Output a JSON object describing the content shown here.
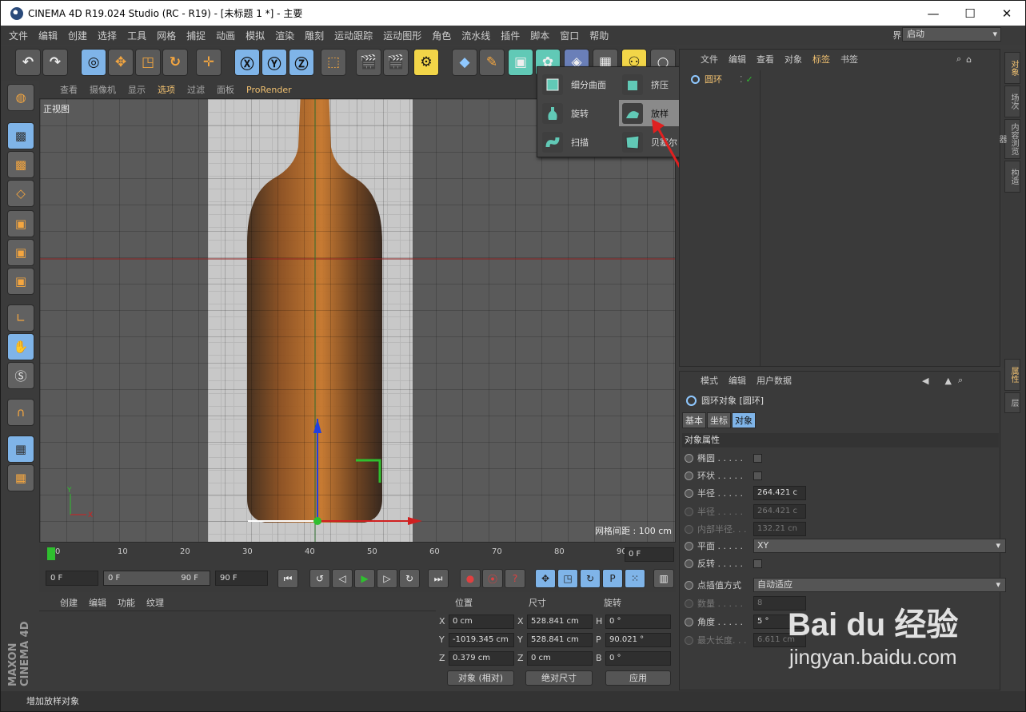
{
  "window": {
    "title": "CINEMA 4D R19.024 Studio (RC - R19) - [未标题 1 *] - 主要"
  },
  "menu": [
    "文件",
    "编辑",
    "创建",
    "选择",
    "工具",
    "网格",
    "捕捉",
    "动画",
    "模拟",
    "渲染",
    "雕刻",
    "运动跟踪",
    "运动图形",
    "角色",
    "流水线",
    "插件",
    "脚本",
    "窗口",
    "帮助"
  ],
  "layout": {
    "label": "界面:",
    "value": "启动"
  },
  "viewport_menu": [
    "查看",
    "摄像机",
    "显示",
    "选项",
    "过滤",
    "面板",
    "ProRender"
  ],
  "viewport": {
    "name": "正视图",
    "grid_info": "网格间距 : 100 cm"
  },
  "popup": {
    "items": [
      {
        "label": "细分曲面",
        "icon": "subdivision-surface-icon"
      },
      {
        "label": "挤压",
        "icon": "extrude-icon"
      },
      {
        "label": "旋转",
        "icon": "lathe-icon"
      },
      {
        "label": "放样",
        "icon": "loft-icon"
      },
      {
        "label": "扫描",
        "icon": "sweep-icon"
      },
      {
        "label": "贝塞尔",
        "icon": "bezier-icon"
      }
    ],
    "highlighted": "放样"
  },
  "timeline": {
    "ticks": [
      "0",
      "10",
      "20",
      "30",
      "40",
      "50",
      "60",
      "70",
      "80",
      "90"
    ],
    "current_frame": "0 F"
  },
  "transport": {
    "start": "0 F",
    "range_start": "0 F",
    "range_end": "90 F",
    "end": "90 F"
  },
  "material_menu": [
    "创建",
    "编辑",
    "功能",
    "纹理"
  ],
  "coords": {
    "headers": {
      "position": "位置",
      "size": "尺寸",
      "rotation": "旋转"
    },
    "rows": [
      {
        "axis": "X",
        "pos": "0 cm",
        "size_axis": "X",
        "size": "528.841 cm",
        "rot_axis": "H",
        "rot": "0 °"
      },
      {
        "axis": "Y",
        "pos": "-1019.345 cm",
        "size_axis": "Y",
        "size": "528.841 cm",
        "rot_axis": "P",
        "rot": "90.021 °"
      },
      {
        "axis": "Z",
        "pos": "0.379 cm",
        "size_axis": "Z",
        "size": "0 cm",
        "rot_axis": "B",
        "rot": "0 °"
      }
    ],
    "mode": "对象 (相对)",
    "size_mode": "绝对尺寸",
    "apply": "应用"
  },
  "object_menu": [
    "文件",
    "编辑",
    "查看",
    "对象",
    "标签",
    "书签"
  ],
  "object": {
    "name": "圆环"
  },
  "attr_menu": [
    "模式",
    "编辑",
    "用户数据"
  ],
  "attr": {
    "title": "圆环对象 [圆环]",
    "tabs": [
      "基本",
      "坐标",
      "对象"
    ],
    "section": "对象属性",
    "rows": [
      {
        "label": "椭圆 . . . . .",
        "type": "check"
      },
      {
        "label": "环状 . . . . .",
        "type": "check"
      },
      {
        "label": "半径 . . . . .",
        "type": "field",
        "value": "264.421 c"
      },
      {
        "label": "半径 . . . . .",
        "type": "field",
        "value": "264.421 c",
        "dim": true
      },
      {
        "label": "内部半径. . .",
        "type": "field",
        "value": "132.21 cn",
        "dim": true
      },
      {
        "label": "平面 . . . . .",
        "type": "select",
        "value": "XY"
      },
      {
        "label": "反转 . . . . .",
        "type": "check"
      },
      {
        "label": "点插值方式",
        "type": "select",
        "value": "自动适应"
      },
      {
        "label": "数量 . . . . .",
        "type": "field",
        "value": "8",
        "dim": true
      },
      {
        "label": "角度 . . . . .",
        "type": "field",
        "value": "5 °"
      },
      {
        "label": "最大长度. . .",
        "type": "field",
        "value": "6.611 cm",
        "dim": true
      }
    ]
  },
  "right_tabs": [
    "对象",
    "场次",
    "内容浏览器",
    "构造"
  ],
  "right_tabs2": [
    "属性",
    "层"
  ],
  "status": "增加放样对象",
  "brand": "MAXON CINEMA 4D",
  "watermark": {
    "logo": "Bai du 经验",
    "url": "jingyan.baidu.com"
  },
  "accent_colors": {
    "highlight": "#f0c070",
    "selected": "#7fb4e8",
    "window_bg": "#3b3b3b"
  }
}
